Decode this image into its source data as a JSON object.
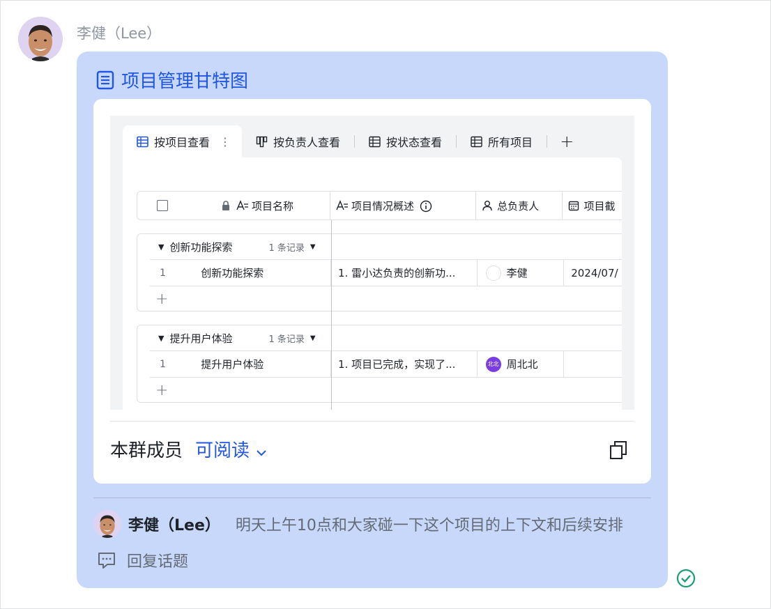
{
  "sender": {
    "name": "李健（Lee）"
  },
  "doc": {
    "title": "项目管理甘特图",
    "tabs": [
      {
        "label": "按项目查看",
        "icon": "grid-view-icon",
        "active": true
      },
      {
        "label": "按负责人查看",
        "icon": "kanban-icon",
        "active": false
      },
      {
        "label": "按状态查看",
        "icon": "grid-view-icon",
        "active": false
      },
      {
        "label": "所有项目",
        "icon": "grid-view-icon",
        "active": false
      }
    ],
    "add_tab": "+",
    "tab_more": "⋮",
    "columns": {
      "name": "项目名称",
      "summary": "项目情况概述",
      "owner": "总负责人",
      "deadline": "项目截"
    },
    "groups": [
      {
        "name": "创新功能探索",
        "count": "1 条记录",
        "rows": [
          {
            "index": "1",
            "name": "创新功能探索",
            "summary": "1. 雷小达负责的创新功...",
            "owner": "李健",
            "owner_avatar": "",
            "deadline": "2024/07/"
          }
        ]
      },
      {
        "name": "提升用户体验",
        "count": "1 条记录",
        "rows": [
          {
            "index": "1",
            "name": "提升用户体验",
            "summary": "1. 项目已完成，实现了...",
            "owner": "周北北",
            "owner_avatar": "北北",
            "deadline": ""
          }
        ]
      }
    ],
    "permission": {
      "label": "本群成员",
      "value": "可阅读"
    }
  },
  "quote": {
    "author": "李健（Lee）",
    "text": "明天上午10点和大家碰一下这个项目的上下文和后续安排"
  },
  "reply": {
    "label": "回复话题"
  },
  "colors": {
    "bubble": "#c7d8fb",
    "accent": "#2156e0",
    "success": "#1a9e77",
    "avatar_purple": "#7b3ce0"
  }
}
